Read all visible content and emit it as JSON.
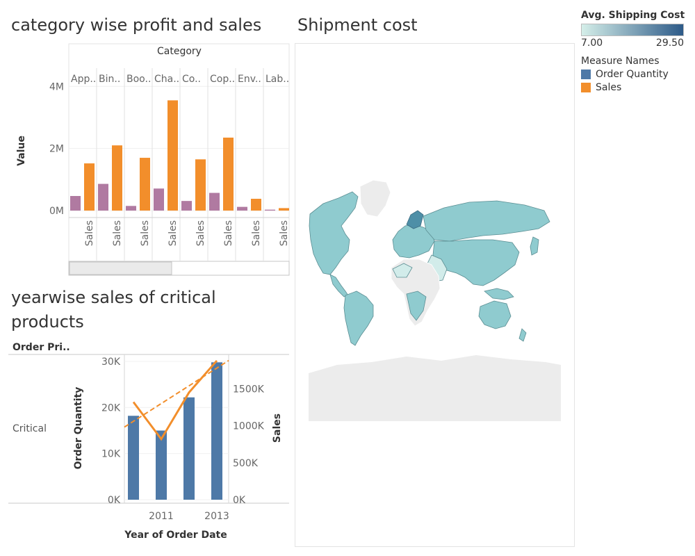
{
  "titles": {
    "category_chart": "category wise profit and sales",
    "map": "Shipment cost",
    "yearwise_line1": "yearwise sales of critical",
    "yearwise_line2": "products"
  },
  "legend": {
    "shipping_title": "Avg. Shipping Cost",
    "shipping_min": "7.00",
    "shipping_max": "29.50",
    "shipping_color_low": "#d5efe9",
    "shipping_color_high": "#2d5a88",
    "measure_title": "Measure Names",
    "items": [
      {
        "label": "Order Quantity",
        "color": "#4e79a7"
      },
      {
        "label": "Sales",
        "color": "#f28e2b"
      }
    ]
  },
  "colors": {
    "profit_bar": "#b07aa1",
    "sales_bar": "#f28e2b",
    "order_qty_bar": "#4e79a7",
    "map_country": "#8fcbcf",
    "map_land_nodata": "#ececec"
  },
  "chart_data": [
    {
      "type": "bar",
      "header": "Category",
      "categories": [
        "App..",
        "Bin..",
        "Boo..",
        "Cha..",
        "Co..",
        "Cop..",
        "Env..",
        "Lab.."
      ],
      "sub_label": "Sales",
      "series": [
        {
          "values": [
            0.47,
            0.86,
            0.15,
            0.71,
            0.31,
            0.57,
            0.12,
            0.03
          ]
        },
        {
          "values": [
            1.52,
            2.1,
            1.7,
            3.55,
            1.65,
            2.35,
            0.38,
            0.08
          ]
        }
      ],
      "ylabel": "Value",
      "ylim": [
        0,
        4.7
      ],
      "yticks": [
        {
          "v": 0,
          "label": "0M"
        },
        {
          "v": 2,
          "label": "2M"
        },
        {
          "v": 4,
          "label": "4M"
        }
      ]
    },
    {
      "type": "bar",
      "row_header": "Order Pri..",
      "row_label": "Critical",
      "x": [
        2010,
        2011,
        2012,
        2013
      ],
      "x_tick_labels": [
        {
          "x": 2011,
          "label": "2011"
        },
        {
          "x": 2013,
          "label": "2013"
        }
      ],
      "xlabel": "Year of Order Date",
      "series": [
        {
          "name": "Order Quantity",
          "kind": "bar",
          "values": [
            18200,
            15000,
            22200,
            29800
          ]
        },
        {
          "name": "Sales",
          "kind": "line",
          "values": [
            1320000,
            820000,
            1450000,
            1880000
          ]
        }
      ],
      "trendline": {
        "series": "Sales",
        "start": 1060000,
        "end": 1780000
      },
      "ylabel_left": "Order Quantity",
      "ylabel_right": "Sales",
      "ylim_left": [
        0,
        30000
      ],
      "ylim_right": [
        0,
        1870000
      ],
      "yticks_left": [
        {
          "v": 0,
          "label": "0K"
        },
        {
          "v": 10000,
          "label": "10K"
        },
        {
          "v": 20000,
          "label": "20K"
        },
        {
          "v": 30000,
          "label": "30K"
        }
      ],
      "yticks_right": [
        {
          "v": 0,
          "label": "0K"
        },
        {
          "v": 500000,
          "label": "500K"
        },
        {
          "v": 1000000,
          "label": "1000K"
        },
        {
          "v": 1500000,
          "label": "1500K"
        }
      ]
    }
  ]
}
